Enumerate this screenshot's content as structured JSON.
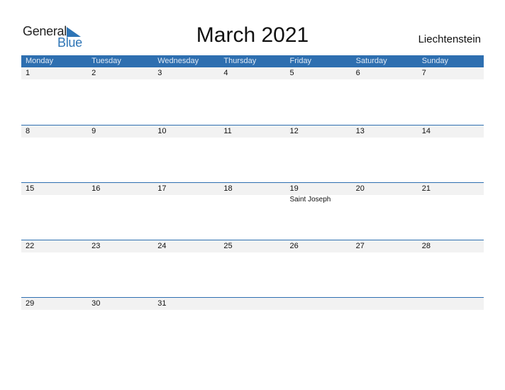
{
  "logo": {
    "word1": "General",
    "word2": "Blue"
  },
  "title": "March 2021",
  "country": "Liechtenstein",
  "colors": {
    "accent": "#2e6fb0",
    "band": "#f2f2f2"
  },
  "weekdays": [
    "Monday",
    "Tuesday",
    "Wednesday",
    "Thursday",
    "Friday",
    "Saturday",
    "Sunday"
  ],
  "weeks": [
    {
      "days": [
        "1",
        "2",
        "3",
        "4",
        "5",
        "6",
        "7"
      ]
    },
    {
      "days": [
        "8",
        "9",
        "10",
        "11",
        "12",
        "13",
        "14"
      ]
    },
    {
      "days": [
        "15",
        "16",
        "17",
        "18",
        "19",
        "20",
        "21"
      ]
    },
    {
      "days": [
        "22",
        "23",
        "24",
        "25",
        "26",
        "27",
        "28"
      ]
    },
    {
      "days": [
        "29",
        "30",
        "31",
        "",
        "",
        "",
        ""
      ]
    }
  ],
  "holidays": [
    {
      "week": 2,
      "day": 4,
      "name": "Saint Joseph"
    }
  ]
}
